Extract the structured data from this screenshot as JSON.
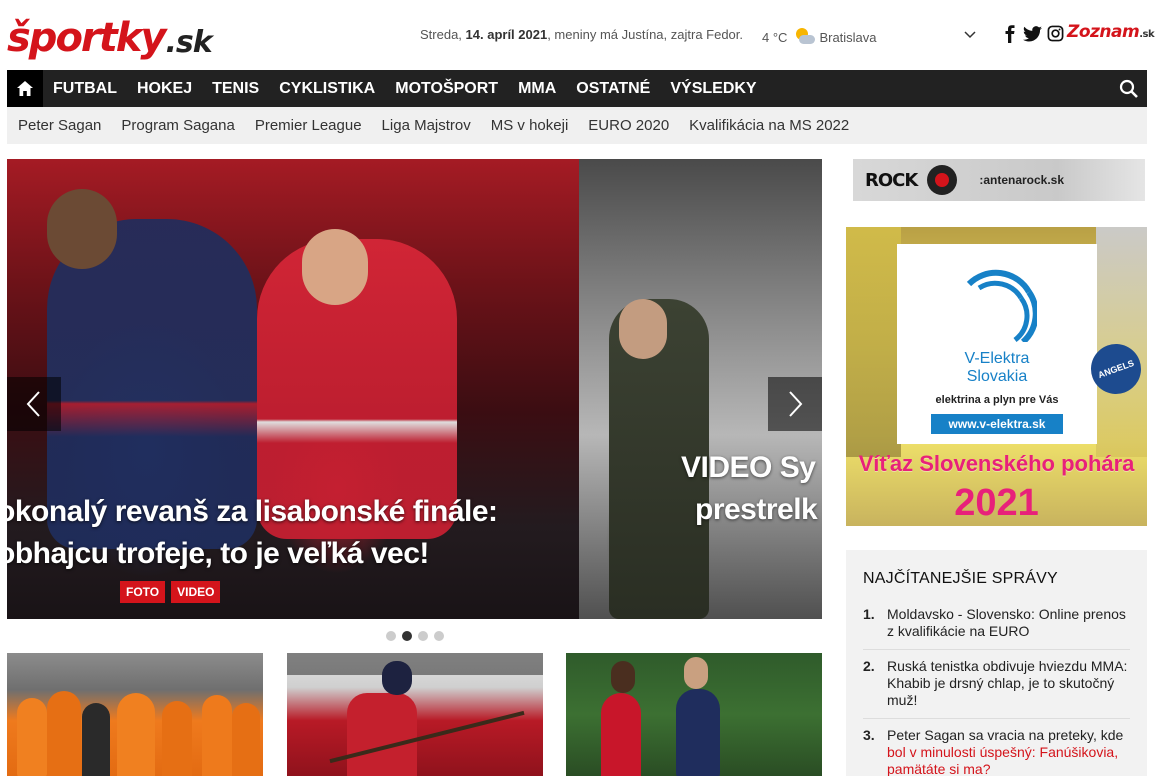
{
  "header": {
    "logo_main": "športky",
    "logo_suffix": ".sk",
    "date_prefix": "Streda, ",
    "date_bold": "14. apríl 2021",
    "date_suffix": ", meniny má Justína, zajtra Fedor.",
    "temperature": "4 °C",
    "weather_icon": "partly-cloudy-icon",
    "city": "Bratislava",
    "zoznam_logo": "Zoznam",
    "zoznam_suffix": ".sk"
  },
  "nav": {
    "items": [
      "FUTBAL",
      "HOKEJ",
      "TENIS",
      "CYKLISTIKA",
      "MOTOŠPORT",
      "MMA",
      "OSTATNÉ",
      "VÝSLEDKY"
    ]
  },
  "subnav": {
    "items": [
      "Peter Sagan",
      "Program Sagana",
      "Premier League",
      "Liga Majstrov",
      "MS v hokeji",
      "EURO 2020",
      "Kvalifikácia na MS 2022"
    ]
  },
  "slider": {
    "main_title_line1": "okonalý revanš za lisabonské finále:",
    "main_title_line2": "obhajcu trofeje, to je veľká vec!",
    "tags": [
      "FOTO",
      "VIDEO"
    ],
    "side_title_line1": "VIDEO Sy",
    "side_title_line2": "prestrelk",
    "dots": 4,
    "active_dot": 1
  },
  "radio": {
    "logo": "ROCK",
    "url": ":antenarock.sk"
  },
  "ad": {
    "brand_line1": "V-Elektra",
    "brand_line2": "Slovakia",
    "tagline": "elektrina a plyn pre Vás",
    "url": "www.v-elektra.sk",
    "headline": "Víťaz Slovenského pohára",
    "year": "2021",
    "badge": "ANGELS"
  },
  "most_read": {
    "title": "NAJČÍTANEJŠIE SPRÁVY",
    "items": [
      {
        "num": "1.",
        "text": "Moldavsko - Slovensko: Online prenos z kvalifikácie na EURO",
        "red": ""
      },
      {
        "num": "2.",
        "text": "Ruská tenistka obdivuje hviezdu MMA: Khabib je drsný chlap, je to skutočný muž!",
        "red": ""
      },
      {
        "num": "3.",
        "text": "Peter Sagan sa vracia na preteky, kde ",
        "red": "bol v minulosti úspešný: Fanúšikovia, pamätáte si ma?"
      }
    ]
  }
}
